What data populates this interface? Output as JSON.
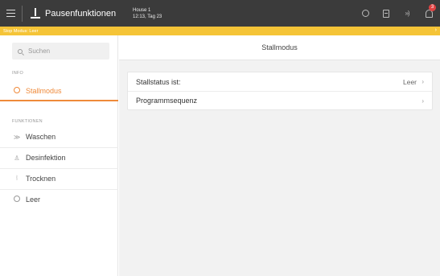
{
  "topbar": {
    "title": "Pausenfunktionen",
    "house_line1": "House 1",
    "house_line2": "12:13, Tag 23",
    "notification_count": "3"
  },
  "stopbar": {
    "text": "Stop Modus: Leer",
    "color": "#f5c437"
  },
  "sidebar": {
    "search_placeholder": "Suchen",
    "info_label": "INFO",
    "active_item": "Stallmodus",
    "funktionen_label": "FUNKTIONEN",
    "items": [
      {
        "label": "Waschen",
        "icon": "wash-icon"
      },
      {
        "label": "Desinfektion",
        "icon": "disinfection-icon"
      },
      {
        "label": "Trocknen",
        "icon": "drying-icon"
      },
      {
        "label": "Leer",
        "icon": "check-circle-icon"
      }
    ],
    "accent": "#ef8a3a"
  },
  "main": {
    "header": "Stallmodus",
    "rows": [
      {
        "label": "Stallstatus ist:",
        "value": "Leer"
      },
      {
        "label": "Programmsequenz",
        "value": ""
      }
    ]
  }
}
